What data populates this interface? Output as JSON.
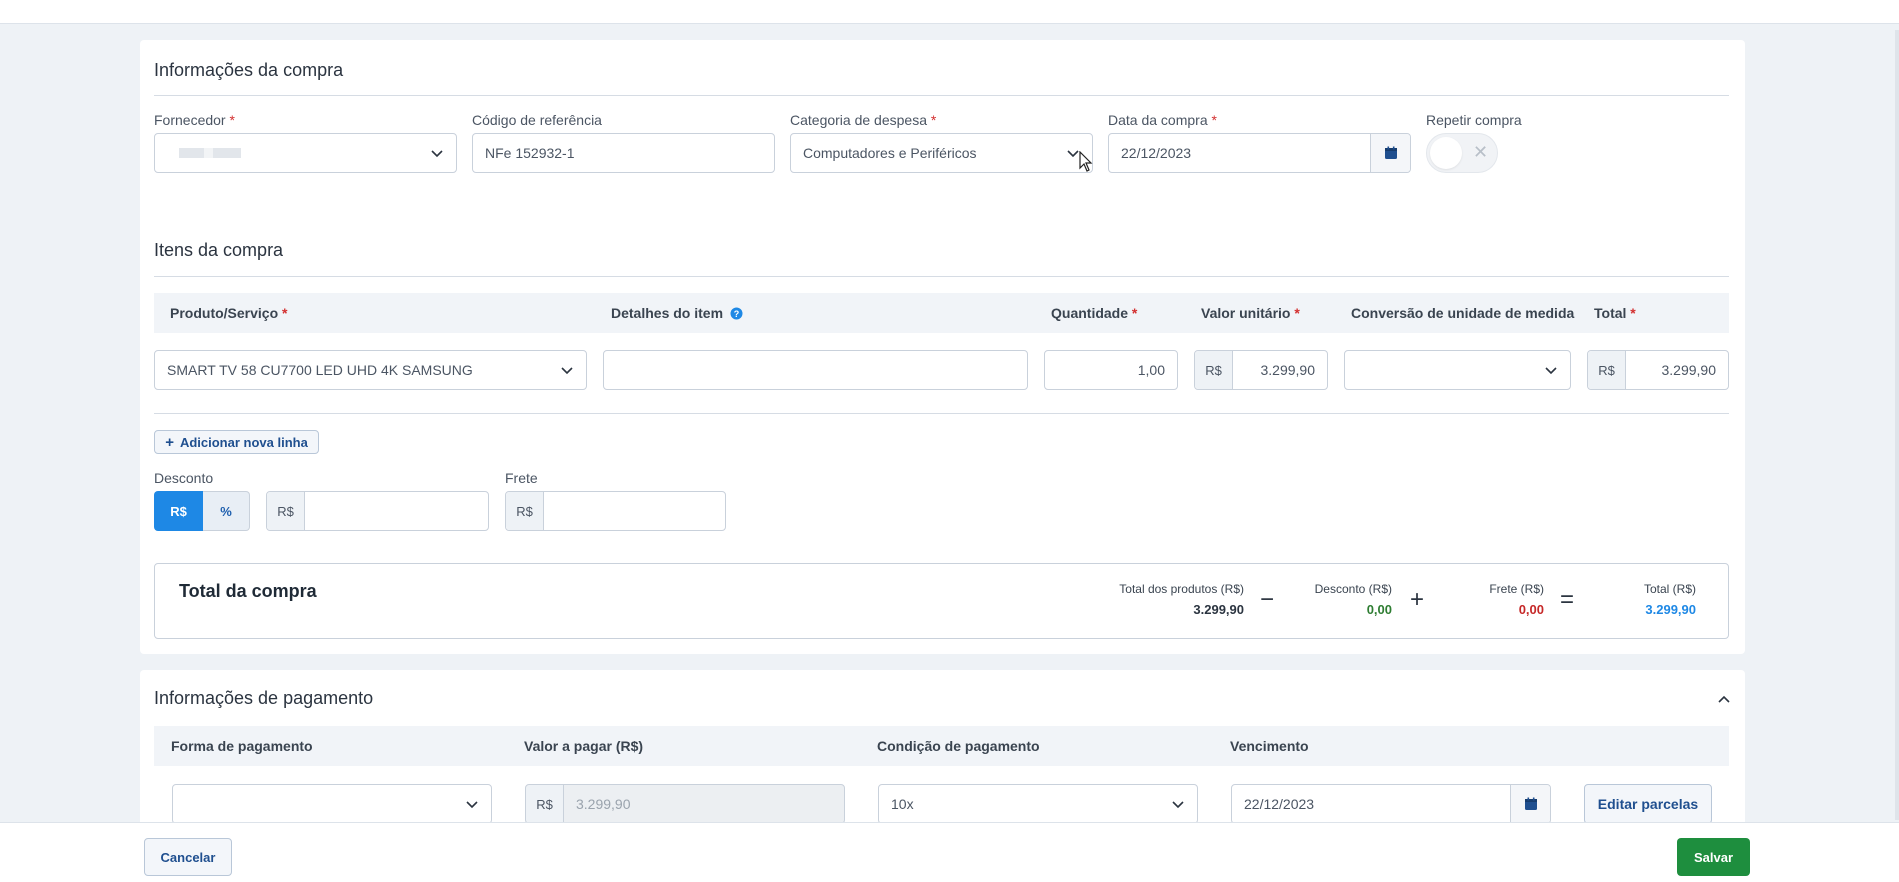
{
  "purchase_info": {
    "title": "Informações da compra",
    "supplier_label": "Fornecedor",
    "supplier_value": "",
    "reference_label": "Código de referência",
    "reference_value": "NFe 152932-1",
    "category_label": "Categoria de despesa",
    "category_value": "Computadores e Periféricos",
    "date_label": "Data da compra",
    "date_value": "22/12/2023",
    "repeat_label": "Repetir compra",
    "repeat_on": false
  },
  "items": {
    "title": "Itens da compra",
    "headers": {
      "product": "Produto/Serviço",
      "details": "Detalhes do item",
      "quantity": "Quantidade",
      "unit_value": "Valor unitário",
      "conversion": "Conversão de unidade de medida",
      "total": "Total"
    },
    "rows": [
      {
        "product": "SMART TV 58 CU7700 LED UHD 4K SAMSUNG",
        "details": "",
        "quantity": "1,00",
        "unit_currency": "R$",
        "unit_value": "3.299,90",
        "conversion": "",
        "total_currency": "R$",
        "total": "3.299,90"
      }
    ],
    "add_line_label": "Adicionar nova linha"
  },
  "discount": {
    "label": "Desconto",
    "mode_currency": "R$",
    "mode_percent": "%",
    "active_mode": "currency",
    "currency": "R$",
    "value": ""
  },
  "freight": {
    "label": "Frete",
    "currency": "R$",
    "value": ""
  },
  "totals": {
    "title": "Total da compra",
    "products_label": "Total dos produtos (R$)",
    "products_value": "3.299,90",
    "discount_label": "Desconto (R$)",
    "discount_value": "0,00",
    "freight_label": "Frete (R$)",
    "freight_value": "0,00",
    "total_label": "Total (R$)",
    "total_value": "3.299,90",
    "op_minus": "−",
    "op_plus": "+",
    "op_equals": "="
  },
  "payment": {
    "title": "Informações de pagamento",
    "headers": {
      "method": "Forma de pagamento",
      "amount": "Valor a pagar (R$)",
      "condition": "Condição de pagamento",
      "due": "Vencimento"
    },
    "method_value": "",
    "amount_currency": "R$",
    "amount_value": "3.299,90",
    "condition_value": "10x",
    "due_value": "22/12/2023",
    "edit_installments_label": "Editar parcelas"
  },
  "footer": {
    "cancel_label": "Cancelar",
    "save_label": "Salvar"
  },
  "colors": {
    "primary": "#1e88e5",
    "success": "#2e7d32",
    "danger": "#c62828",
    "save_button": "#1e8e3e"
  }
}
